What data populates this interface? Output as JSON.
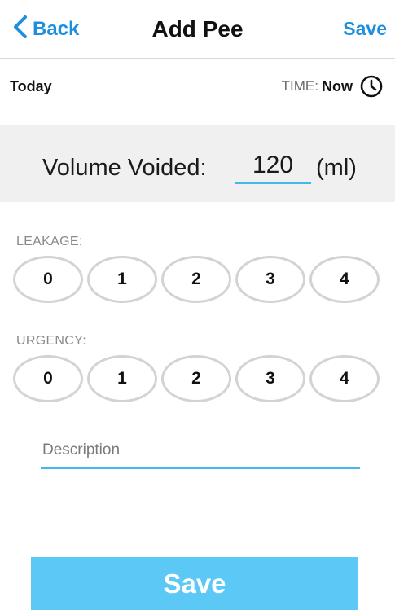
{
  "navbar": {
    "back_label": "Back",
    "title": "Add Pee",
    "save_label": "Save"
  },
  "date_row": {
    "date_label": "Today",
    "time_prefix": "TIME:",
    "time_value": "Now"
  },
  "volume": {
    "label": "Volume Voided:",
    "value": "120",
    "unit": "(ml)"
  },
  "leakage": {
    "label": "LEAKAGE:",
    "options": [
      "0",
      "1",
      "2",
      "3",
      "4"
    ]
  },
  "urgency": {
    "label": "URGENCY:",
    "options": [
      "0",
      "1",
      "2",
      "3",
      "4"
    ]
  },
  "description": {
    "placeholder": "Description"
  },
  "bottom_save_label": "Save",
  "colors": {
    "accent_blue": "#1d8fe0",
    "input_underline": "#46b6ec",
    "save_button": "#5bc8f5",
    "panel_gray": "#f0f0f0",
    "option_border": "#d3d3d3"
  },
  "icons": {
    "back": "chevron-left-icon",
    "time": "clock-icon"
  }
}
